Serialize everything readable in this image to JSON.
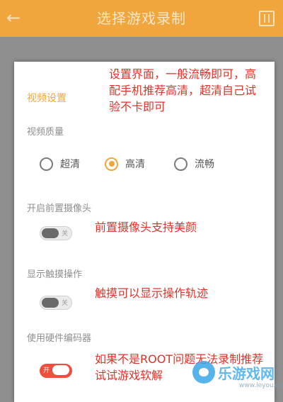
{
  "header": {
    "title": "选择游戏录制",
    "back_icon": "←",
    "menu_icon": "grid-icon"
  },
  "colors": {
    "accent": "#f0a63c",
    "annotation_red": "#e0322a",
    "toggle_on": "#ee4f3c"
  },
  "dialog": {
    "section_title": "视频设置",
    "quality": {
      "label": "视频质量",
      "options": [
        {
          "label": "超清",
          "selected": false
        },
        {
          "label": "高清",
          "selected": true
        },
        {
          "label": "流畅",
          "selected": false
        }
      ]
    },
    "front_camera": {
      "label": "开启前置摄像头",
      "state": "off",
      "state_text": "关"
    },
    "touch_display": {
      "label": "显示触摸操作",
      "state": "off",
      "state_text": "关"
    },
    "hardware_encoder": {
      "label": "使用硬件编码器",
      "state": "on",
      "state_text": "开"
    }
  },
  "annotations": {
    "settings_note": "设置界面，一般流畅即可，高配手机推荐高清，超清自己试验不卡即可",
    "camera_note": "前置摄像头支持美颜",
    "touch_note": "触摸可以显示操作轨迹",
    "root_note": "如果不是ROOT问题无法录制推荐试试游戏软解"
  },
  "watermark": {
    "name": "乐游戏网",
    "url": "www.leyouxi.net"
  }
}
